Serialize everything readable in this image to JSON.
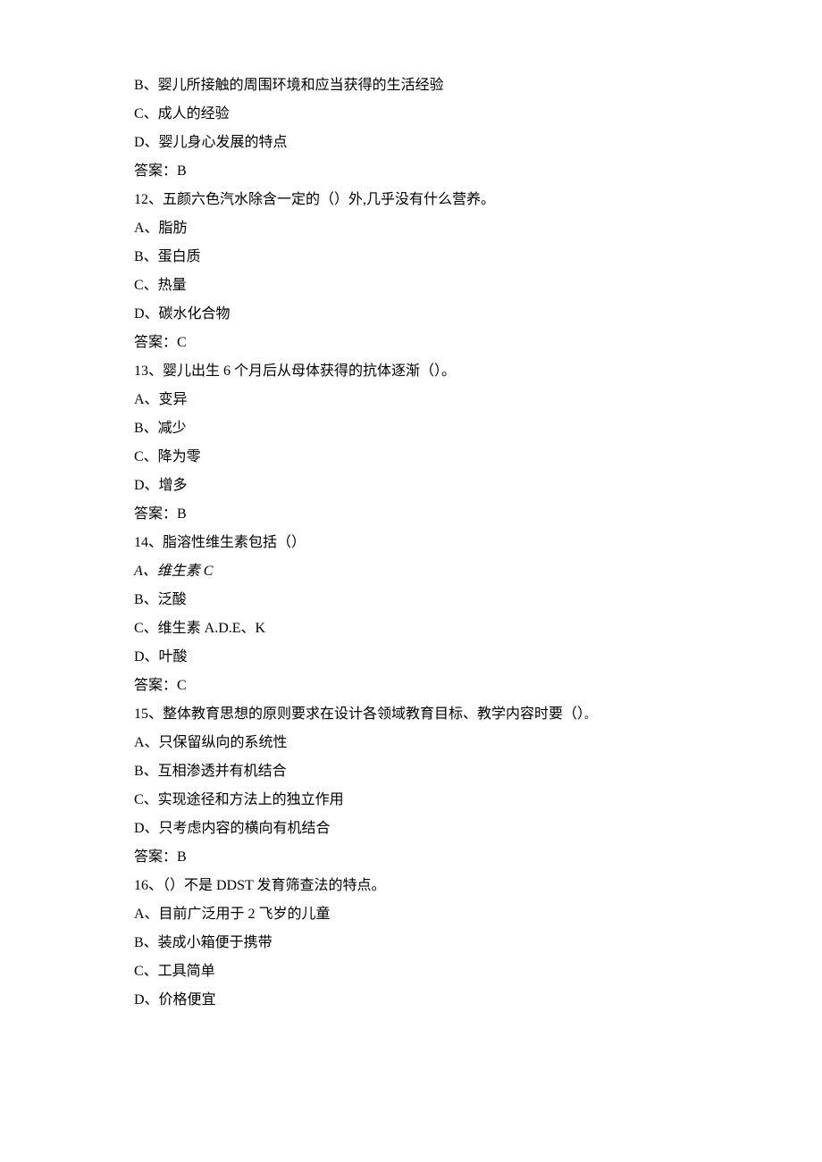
{
  "lines": [
    "B、婴儿所接触的周围环境和应当获得的生活经验",
    "C、成人的经验",
    "D、婴儿身心发展的特点",
    "答案：B",
    "12、五颜六色汽水除含一定的（）外,几乎没有什么营养。",
    "A、脂肪",
    "B、蛋白质",
    "C、热量",
    "D、碳水化合物",
    "答案：C",
    "13、婴儿出生 6 个月后从母体获得的抗体逐渐（）。",
    "A、变异",
    "B、减少",
    "C、降为零",
    "D、增多",
    "答案：B",
    "14、脂溶性维生素包括（）",
    "A、维生素 C",
    "B、泛酸",
    "C、维生素 A.D.E、K",
    "D、叶酸",
    "答案：C",
    "15、整体教育思想的原则要求在设计各领域教育目标、教学内容时要（）",
    "A、只保留纵向的系统性",
    "B、互相渗透并有机结合",
    "C、实现途径和方法上的独立作用",
    "D、只考虑内容的横向有机结合",
    "答案：B",
    "16、（）不是 DDST 发育筛查法的特点。",
    "A、目前广泛用于 2 飞岁的儿童",
    "B、装成小箱便于携带",
    "C、工具简单",
    "D、价格便宜"
  ],
  "q15_trailing_punct": "。",
  "italic_line_index": 17
}
